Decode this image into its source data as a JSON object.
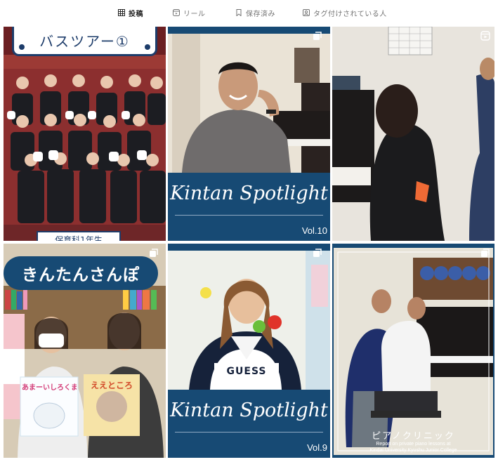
{
  "tabs": [
    {
      "label": "投稿",
      "icon": "grid-icon",
      "active": true
    },
    {
      "label": "リール",
      "icon": "reels-icon",
      "active": false
    },
    {
      "label": "保存済み",
      "icon": "bookmark-icon",
      "active": false
    },
    {
      "label": "タグ付けされている人",
      "icon": "tagged-icon",
      "active": false
    }
  ],
  "posts": [
    {
      "title": "バスツアー①",
      "bottom_text": "保育科1年生",
      "badge": "multi-photo-icon"
    },
    {
      "title": "Kintan Spotlight",
      "vol": "Vol.10",
      "badge": "multi-photo-icon"
    },
    {
      "badge": "reel-icon"
    },
    {
      "title": "きんたんさんぽ",
      "book1": "あまーいしろくま",
      "book2": "ええところ",
      "badge": "multi-photo-icon"
    },
    {
      "title": "Kintan Spotlight",
      "vol": "Vol.9",
      "shirt": "GUESS",
      "badge": "multi-photo-icon"
    },
    {
      "title": "ピアノクリニック",
      "subtitle": "Report on private piano lessons at",
      "subtitle2": "Kindai University Kyushu Junior College",
      "badge": "multi-photo-icon"
    }
  ],
  "colors": {
    "navy": "#174a74",
    "text_active": "#262626",
    "text_inactive": "#737373"
  }
}
